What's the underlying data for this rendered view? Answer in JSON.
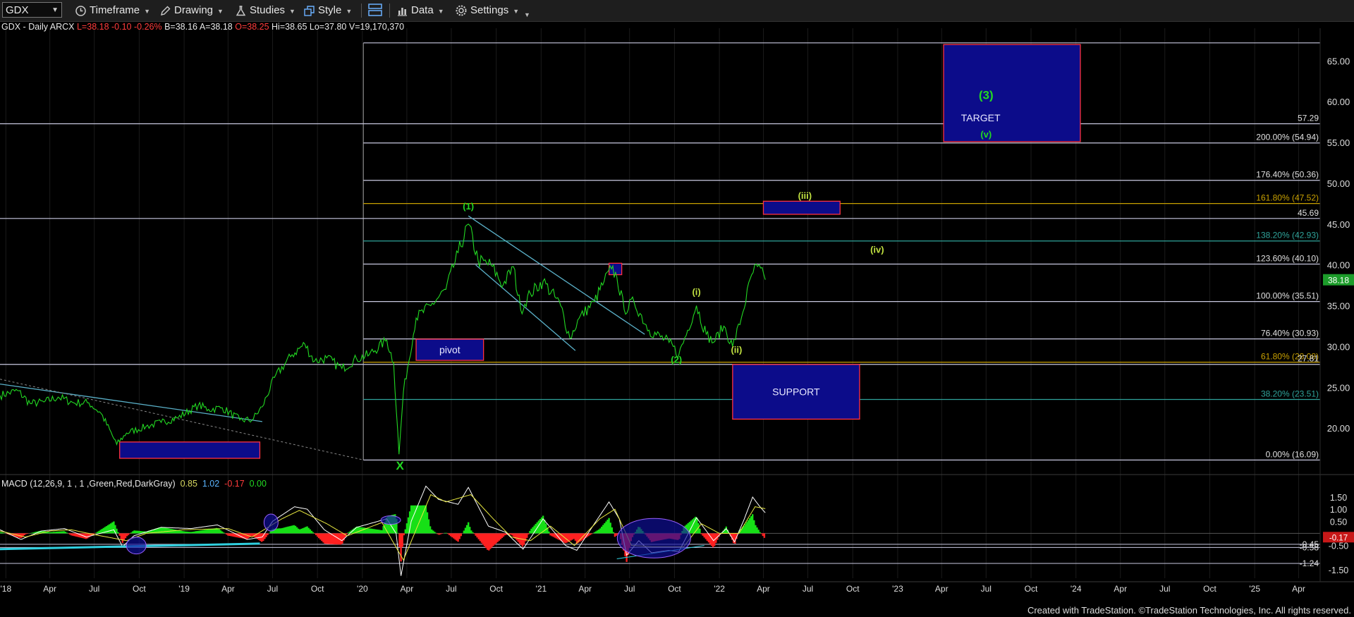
{
  "toolbar": {
    "symbol": "GDX",
    "timeframe": "Timeframe",
    "drawing": "Drawing",
    "studies": "Studies",
    "style": "Style",
    "data": "Data",
    "settings": "Settings"
  },
  "header": {
    "symbol_line": "GDX - Daily  ARCX",
    "last": "L=38.18",
    "change": "-0.10",
    "pct": "-0.26%",
    "bid": "B=38.16",
    "ask": "A=38.18",
    "open": "O=38.25",
    "high": "Hi=38.65",
    "low": "Lo=37.80",
    "volume": "V=19,170,370"
  },
  "macd_header": {
    "label": "MACD (12,26,9, 1 , 1 ,Green,Red,DarkGray)",
    "v1": "0.85",
    "v2": "1.02",
    "v3": "-0.17",
    "v4": "0.00"
  },
  "footer": "Created with TradeStation. ©TradeStation Technologies, Inc. All rights reserved.",
  "colors": {
    "price": "#22d822",
    "macd": "#ffffff",
    "signal": "#e8e840",
    "hist_pos": "#16e016",
    "hist_neg": "#ff2020",
    "box_fill": "#0c0c8a",
    "box_edge": "#ff3040",
    "level": "#c8c8e0",
    "teal": "#2fa39a",
    "fib_gold": "#c8a000"
  },
  "chart_data": {
    "type": "line",
    "title": "GDX - Daily",
    "x_axis": {
      "type": "date",
      "range": [
        "2017-12-20",
        "2025-05-15"
      ],
      "tick_labels": [
        {
          "date": "2018-01-01",
          "label": "'18"
        },
        {
          "date": "2018-04-01",
          "label": "Apr"
        },
        {
          "date": "2018-07-01",
          "label": "Jul"
        },
        {
          "date": "2018-10-01",
          "label": "Oct"
        },
        {
          "date": "2019-01-01",
          "label": "'19"
        },
        {
          "date": "2019-04-01",
          "label": "Apr"
        },
        {
          "date": "2019-07-01",
          "label": "Jul"
        },
        {
          "date": "2019-10-01",
          "label": "Oct"
        },
        {
          "date": "2020-01-01",
          "label": "'20"
        },
        {
          "date": "2020-04-01",
          "label": "Apr"
        },
        {
          "date": "2020-07-01",
          "label": "Jul"
        },
        {
          "date": "2020-10-01",
          "label": "Oct"
        },
        {
          "date": "2021-01-01",
          "label": "'21"
        },
        {
          "date": "2021-04-01",
          "label": "Apr"
        },
        {
          "date": "2021-07-01",
          "label": "Jul"
        },
        {
          "date": "2021-10-01",
          "label": "Oct"
        },
        {
          "date": "2022-01-01",
          "label": "'22"
        },
        {
          "date": "2022-04-01",
          "label": "Apr"
        },
        {
          "date": "2022-07-01",
          "label": "Jul"
        },
        {
          "date": "2022-10-01",
          "label": "Oct"
        },
        {
          "date": "2023-01-01",
          "label": "'23"
        },
        {
          "date": "2023-04-01",
          "label": "Apr"
        },
        {
          "date": "2023-07-01",
          "label": "Jul"
        },
        {
          "date": "2023-10-01",
          "label": "Oct"
        },
        {
          "date": "2024-01-01",
          "label": "'24"
        },
        {
          "date": "2024-04-01",
          "label": "Apr"
        },
        {
          "date": "2024-07-01",
          "label": "Jul"
        },
        {
          "date": "2024-10-01",
          "label": "Oct"
        },
        {
          "date": "2025-01-01",
          "label": "'25"
        },
        {
          "date": "2025-04-01",
          "label": "Apr"
        }
      ]
    },
    "price_panel": {
      "y_range": [
        15.0,
        69.0
      ],
      "y_ticks": [
        20,
        25,
        30,
        35,
        40,
        45,
        50,
        55,
        60,
        65
      ],
      "last_price": 38.18,
      "series": {
        "name": "GDX",
        "points": [
          [
            "2017-12-20",
            24.0
          ],
          [
            "2018-01-25",
            24.6
          ],
          [
            "2018-02-20",
            23.0
          ],
          [
            "2018-03-20",
            23.2
          ],
          [
            "2018-04-18",
            23.8
          ],
          [
            "2018-05-20",
            23.1
          ],
          [
            "2018-06-20",
            23.1
          ],
          [
            "2018-07-15",
            21.8
          ],
          [
            "2018-08-16",
            18.0
          ],
          [
            "2018-09-05",
            19.4
          ],
          [
            "2018-10-15",
            20.2
          ],
          [
            "2018-11-15",
            20.7
          ],
          [
            "2018-12-20",
            21.3
          ],
          [
            "2019-01-30",
            22.8
          ],
          [
            "2019-02-20",
            22.3
          ],
          [
            "2019-03-20",
            22.5
          ],
          [
            "2019-04-25",
            21.0
          ],
          [
            "2019-05-20",
            21.0
          ],
          [
            "2019-06-10",
            22.6
          ],
          [
            "2019-07-05",
            26.2
          ],
          [
            "2019-08-10",
            29.0
          ],
          [
            "2019-09-05",
            30.3
          ],
          [
            "2019-09-25",
            28.2
          ],
          [
            "2019-10-20",
            28.6
          ],
          [
            "2019-11-20",
            27.3
          ],
          [
            "2019-12-20",
            28.5
          ],
          [
            "2020-01-15",
            29.0
          ],
          [
            "2020-02-20",
            30.8
          ],
          [
            "2020-03-05",
            28.0
          ],
          [
            "2020-03-16",
            16.8
          ],
          [
            "2020-03-25",
            24.5
          ],
          [
            "2020-04-20",
            33.5
          ],
          [
            "2020-05-20",
            35.0
          ],
          [
            "2020-06-20",
            37.0
          ],
          [
            "2020-07-15",
            41.5
          ],
          [
            "2020-08-05",
            45.0
          ],
          [
            "2020-08-25",
            40.5
          ],
          [
            "2020-09-20",
            40.0
          ],
          [
            "2020-10-15",
            37.5
          ],
          [
            "2020-11-05",
            39.8
          ],
          [
            "2020-11-20",
            34.5
          ],
          [
            "2020-12-10",
            36.5
          ],
          [
            "2021-01-05",
            38.0
          ],
          [
            "2021-02-10",
            35.0
          ],
          [
            "2021-03-01",
            31.0
          ],
          [
            "2021-03-20",
            33.5
          ],
          [
            "2021-04-20",
            35.5
          ],
          [
            "2021-05-10",
            38.0
          ],
          [
            "2021-05-25",
            39.5
          ],
          [
            "2021-06-05",
            38.5
          ],
          [
            "2021-06-20",
            34.5
          ],
          [
            "2021-07-10",
            35.5
          ],
          [
            "2021-08-10",
            32.0
          ],
          [
            "2021-09-20",
            30.5
          ],
          [
            "2021-10-10",
            29.0
          ],
          [
            "2021-11-15",
            35.0
          ],
          [
            "2021-12-05",
            31.5
          ],
          [
            "2021-12-20",
            30.5
          ],
          [
            "2022-01-10",
            32.5
          ],
          [
            "2022-01-28",
            30.0
          ],
          [
            "2022-02-15",
            33.5
          ],
          [
            "2022-03-08",
            38.8
          ],
          [
            "2022-03-20",
            39.8
          ],
          [
            "2022-04-05",
            38.18
          ]
        ]
      }
    },
    "levels": [
      {
        "label": "57.29",
        "value": 57.29,
        "from": "2017-12-20",
        "color": "#c8c8e0"
      },
      {
        "label": "200.00% (54.94)",
        "value": 54.94,
        "from": "2020-01-03",
        "color": "#c8c8e0"
      },
      {
        "label": "176.40% (50.36)",
        "value": 50.36,
        "from": "2020-01-03",
        "color": "#c8c8e0"
      },
      {
        "label": "161.80% (47.52)",
        "value": 47.52,
        "from": "2020-01-03",
        "color": "#c8a000"
      },
      {
        "label": "45.69",
        "value": 45.69,
        "from": "2017-12-20",
        "color": "#c8c8e0"
      },
      {
        "label": "138.20% (42.93)",
        "value": 42.93,
        "from": "2020-01-03",
        "color": "#2fa39a"
      },
      {
        "label": "123.60% (40.10)",
        "value": 40.1,
        "from": "2020-01-03",
        "color": "#c8c8e0"
      },
      {
        "label": "100.00% (35.51)",
        "value": 35.51,
        "from": "2020-01-03",
        "color": "#c8c8e0"
      },
      {
        "label": "76.40% (30.93)",
        "value": 30.93,
        "from": "2020-01-03",
        "color": "#c8c8e0"
      },
      {
        "label": "61.80% (28.08)",
        "value": 28.08,
        "from": "2020-01-03",
        "color": "#c8a000"
      },
      {
        "label": "27.81",
        "value": 27.81,
        "from": "2017-12-20",
        "color": "#c8c8e0"
      },
      {
        "label": "38.20% (23.51)",
        "value": 23.51,
        "from": "2020-01-03",
        "color": "#2fa39a"
      },
      {
        "label": "0.00% (16.09)",
        "value": 16.09,
        "from": "2020-01-03",
        "color": "#c8c8e0"
      },
      {
        "label": "",
        "value": 67.2,
        "from": "2020-01-03",
        "color": "#c8c8e0"
      }
    ],
    "boxes": [
      {
        "label": "TARGET",
        "x1": "2023-04-05",
        "x2": "2024-01-10",
        "y1": 55.1,
        "y2": 67.0
      },
      {
        "label": "SUPPORT",
        "x1": "2022-01-28",
        "x2": "2022-10-15",
        "y1": 21.1,
        "y2": 27.8
      },
      {
        "label": "pivot",
        "x1": "2020-04-20",
        "x2": "2020-09-05",
        "y1": 28.3,
        "y2": 30.9
      },
      {
        "label": "",
        "x1": "2018-08-22",
        "x2": "2019-06-05",
        "y1": 16.3,
        "y2": 18.3
      },
      {
        "label": "",
        "x1": "2022-04-01",
        "x2": "2022-09-05",
        "y1": 46.2,
        "y2": 47.8
      },
      {
        "label": "",
        "x1": "2021-05-20",
        "x2": "2021-06-15",
        "y1": 38.8,
        "y2": 40.2
      }
    ],
    "wave_labels": [
      {
        "text": "(1)",
        "date": "2020-08-05",
        "value": 46.8,
        "color": "#22d822",
        "size": 13
      },
      {
        "text": "(2)",
        "date": "2021-10-05",
        "value": 28.0,
        "color": "#22d822",
        "size": 13
      },
      {
        "text": "(3)",
        "date": "2023-07-01",
        "value": 60.3,
        "color": "#22d822",
        "size": 17
      },
      {
        "text": "(v)",
        "date": "2023-07-01",
        "value": 55.6,
        "color": "#22d822",
        "size": 13
      },
      {
        "text": "(iii)",
        "date": "2022-06-25",
        "value": 48.1,
        "color": "#c0e040",
        "size": 13
      },
      {
        "text": "(iv)",
        "date": "2022-11-20",
        "value": 41.5,
        "color": "#c0e040",
        "size": 13
      },
      {
        "text": "(i)",
        "date": "2021-11-15",
        "value": 36.3,
        "color": "#c0e040",
        "size": 13
      },
      {
        "text": "(ii)",
        "date": "2022-02-05",
        "value": 29.2,
        "color": "#c0e040",
        "size": 13
      },
      {
        "text": "X",
        "date": "2020-03-18",
        "value": 14.9,
        "color": "#22d822",
        "size": 17
      }
    ],
    "trendlines": [
      {
        "from": [
          "2020-08-05",
          46.0
        ],
        "to": [
          "2021-08-01",
          31.5
        ],
        "color": "#5ab0c8"
      },
      {
        "from": [
          "2020-08-20",
          40.0
        ],
        "to": [
          "2021-03-12",
          29.5
        ],
        "color": "#5ab0c8"
      },
      {
        "from": [
          "2017-12-20",
          25.4
        ],
        "to": [
          "2019-06-10",
          20.8
        ],
        "color": "#5ab0c8"
      },
      {
        "from": [
          "2017-12-20",
          26.0
        ],
        "to": [
          "2020-01-03",
          16.1
        ],
        "color": "#888888",
        "dashed": true
      }
    ],
    "macd_panel": {
      "name": "MACD (12,26,9, 1 , 1 ,Green,Red,DarkGray)",
      "y_range": [
        -1.85,
        2.05
      ],
      "y_ticks": [
        1.5,
        1.0,
        0.5,
        -0.5,
        -1.5
      ],
      "y_tick_labels": [
        "1.50",
        "1.00",
        "0.50",
        "-0.50",
        "-1.50"
      ],
      "value_labels": [
        "0.85",
        "1.02",
        "-0.17",
        "0.00"
      ],
      "reference_lines": [
        -0.45,
        -0.58,
        -1.24
      ],
      "reference_labels": [
        "-0.45",
        "-0.58",
        "-1.24"
      ],
      "macd_points": [
        [
          "2017-12-20",
          0.15
        ],
        [
          "2018-02-01",
          -0.25
        ],
        [
          "2018-03-15",
          0.1
        ],
        [
          "2018-05-01",
          0.2
        ],
        [
          "2018-06-15",
          -0.15
        ],
        [
          "2018-08-10",
          0.15
        ],
        [
          "2018-08-28",
          -0.55
        ],
        [
          "2018-09-20",
          -0.1
        ],
        [
          "2018-11-15",
          0.25
        ],
        [
          "2019-01-15",
          0.2
        ],
        [
          "2019-03-10",
          0.35
        ],
        [
          "2019-05-10",
          -0.25
        ],
        [
          "2019-06-10",
          -0.15
        ],
        [
          "2019-07-01",
          0.5
        ],
        [
          "2019-08-15",
          1.1
        ],
        [
          "2019-09-10",
          1.0
        ],
        [
          "2019-10-15",
          0.15
        ],
        [
          "2019-11-20",
          -0.3
        ],
        [
          "2019-12-20",
          0.25
        ],
        [
          "2020-02-20",
          0.6
        ],
        [
          "2020-03-10",
          0.0
        ],
        [
          "2020-03-20",
          -1.75
        ],
        [
          "2020-04-10",
          0.5
        ],
        [
          "2020-05-10",
          1.95
        ],
        [
          "2020-06-05",
          1.4
        ],
        [
          "2020-07-15",
          1.2
        ],
        [
          "2020-08-05",
          1.9
        ],
        [
          "2020-09-15",
          0.3
        ],
        [
          "2020-10-20",
          0.05
        ],
        [
          "2020-11-25",
          -0.65
        ],
        [
          "2021-01-05",
          0.6
        ],
        [
          "2021-02-20",
          -0.5
        ],
        [
          "2021-03-15",
          -0.7
        ],
        [
          "2021-04-20",
          0.4
        ],
        [
          "2021-05-20",
          1.3
        ],
        [
          "2021-06-10",
          0.6
        ],
        [
          "2021-06-25",
          -0.9
        ],
        [
          "2021-07-20",
          -0.3
        ],
        [
          "2021-08-15",
          -0.8
        ],
        [
          "2021-09-20",
          -0.7
        ],
        [
          "2021-10-10",
          -0.75
        ],
        [
          "2021-11-15",
          0.65
        ],
        [
          "2021-12-20",
          -0.3
        ],
        [
          "2022-01-15",
          0.2
        ],
        [
          "2022-02-01",
          -0.35
        ],
        [
          "2022-02-20",
          0.55
        ],
        [
          "2022-03-10",
          1.5
        ],
        [
          "2022-03-25",
          1.1
        ],
        [
          "2022-04-05",
          0.85
        ]
      ],
      "signal_points": [
        [
          "2017-12-20",
          0.1
        ],
        [
          "2018-02-10",
          -0.15
        ],
        [
          "2018-04-01",
          0.1
        ],
        [
          "2018-05-15",
          0.15
        ],
        [
          "2018-07-01",
          -0.05
        ],
        [
          "2018-09-05",
          -0.3
        ],
        [
          "2018-10-15",
          0.0
        ],
        [
          "2019-01-01",
          0.15
        ],
        [
          "2019-04-01",
          0.2
        ],
        [
          "2019-05-20",
          -0.15
        ],
        [
          "2019-07-20",
          0.6
        ],
        [
          "2019-08-25",
          0.95
        ],
        [
          "2019-10-20",
          0.4
        ],
        [
          "2019-12-01",
          -0.1
        ],
        [
          "2020-02-10",
          0.45
        ],
        [
          "2020-03-25",
          -1.1
        ],
        [
          "2020-04-25",
          0.4
        ],
        [
          "2020-05-20",
          1.6
        ],
        [
          "2020-06-20",
          1.3
        ],
        [
          "2020-08-10",
          1.6
        ],
        [
          "2020-09-25",
          0.6
        ],
        [
          "2020-11-01",
          -0.15
        ],
        [
          "2020-12-10",
          -0.3
        ],
        [
          "2021-01-20",
          0.3
        ],
        [
          "2021-03-10",
          -0.5
        ],
        [
          "2021-05-01",
          0.6
        ],
        [
          "2021-06-01",
          1.0
        ],
        [
          "2021-07-05",
          -0.5
        ],
        [
          "2021-08-20",
          -0.55
        ],
        [
          "2021-10-20",
          -0.55
        ],
        [
          "2021-11-25",
          0.4
        ],
        [
          "2022-01-01",
          0.0
        ],
        [
          "2022-02-10",
          0.0
        ],
        [
          "2022-03-15",
          1.1
        ],
        [
          "2022-04-05",
          1.02
        ]
      ]
    }
  }
}
